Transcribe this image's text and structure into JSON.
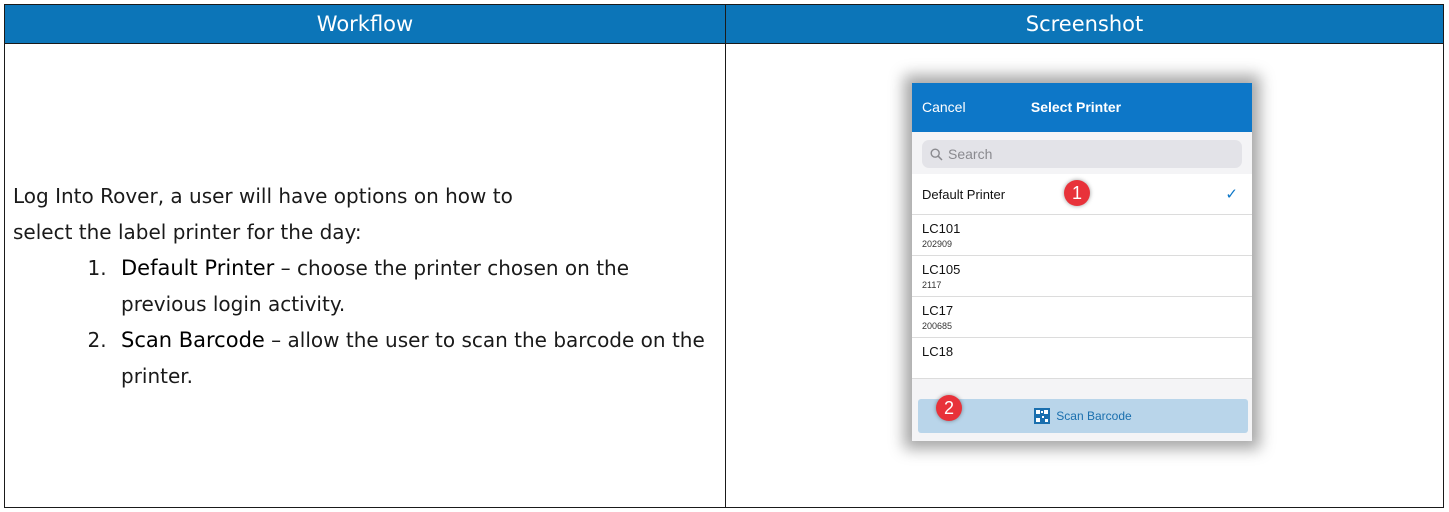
{
  "table": {
    "header_left": "Workflow",
    "header_right": "Screenshot"
  },
  "workflow": {
    "intro_line1": "Log Into Rover, a user will have options on how to",
    "intro_line2": "select the label printer for the day:",
    "items": [
      {
        "term": "Default Printer",
        "description": " – choose the printer chosen on the previous login activity."
      },
      {
        "term": "Scan Barcode",
        "description": " – allow the user to scan the barcode on the printer."
      }
    ]
  },
  "phone": {
    "cancel_label": "Cancel",
    "title": "Select Printer",
    "search_placeholder": "Search",
    "printers": [
      {
        "name": "Default Printer",
        "code": "",
        "selected": true
      },
      {
        "name": "LC101",
        "code": "202909"
      },
      {
        "name": "LC105",
        "code": "2117"
      },
      {
        "name": "LC17",
        "code": "200685"
      },
      {
        "name": "LC18",
        "code": ""
      }
    ],
    "scan_label": "Scan Barcode",
    "badge_1": "1",
    "badge_2": "2",
    "accent_color": "#0d77c8",
    "badge_color": "#e8323a"
  }
}
